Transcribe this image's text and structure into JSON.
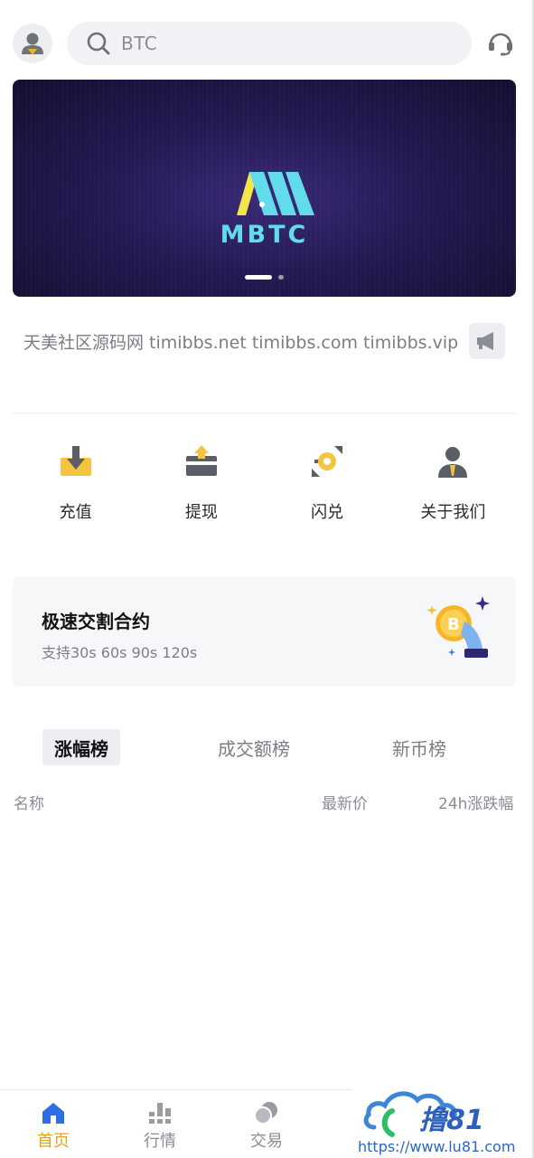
{
  "header": {
    "search_placeholder": "BTC",
    "avatar_icon": "user-avatar-icon",
    "support_icon": "headset-icon"
  },
  "banner": {
    "brand_text": "MBTC",
    "slides": 2,
    "active_slide": 1
  },
  "notice": {
    "text": "天美社区源码网 timibbs.net timibbs.com timibbs.vip",
    "icon": "megaphone-icon"
  },
  "actions": [
    {
      "label": "充值",
      "icon": "deposit-icon"
    },
    {
      "label": "提现",
      "icon": "withdraw-icon"
    },
    {
      "label": "闪兑",
      "icon": "flash-swap-icon"
    },
    {
      "label": "关于我们",
      "icon": "about-us-icon"
    }
  ],
  "promo": {
    "title": "极速交割合约",
    "subtitle": "支持30s 60s 90s 120s",
    "icon": "bitcoin-hand-icon"
  },
  "tabs": [
    {
      "label": "涨幅榜",
      "active": true
    },
    {
      "label": "成交额榜",
      "active": false
    },
    {
      "label": "新币榜",
      "active": false
    }
  ],
  "table": {
    "columns": [
      "名称",
      "最新价",
      "24h涨跌幅"
    ]
  },
  "bottom_nav": [
    {
      "label": "首页",
      "icon": "home-icon",
      "active": true
    },
    {
      "label": "行情",
      "icon": "market-chart-icon",
      "active": false
    },
    {
      "label": "交易",
      "icon": "trade-coins-icon",
      "active": false
    }
  ],
  "watermark": {
    "logo_text": "撸81",
    "url": "https://www.lu81.com"
  },
  "colors": {
    "accent": "#e3a31b",
    "banner_bg": "#231a52",
    "brand_cyan": "#62dcec",
    "brand_yellow": "#f2e64b"
  }
}
